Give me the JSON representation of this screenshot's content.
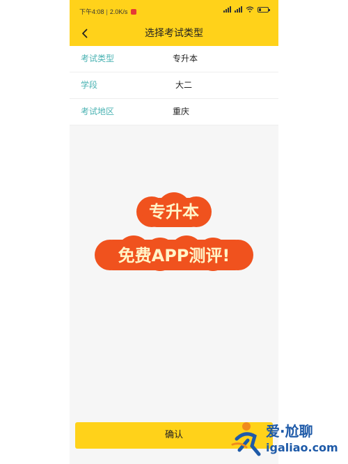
{
  "status_bar": {
    "time": "下午4:08",
    "speed": "2.0K/s",
    "separator": "|"
  },
  "header": {
    "title": "选择考试类型",
    "back_icon": "chevron-left-icon"
  },
  "info": {
    "rows": [
      {
        "label": "考试类型",
        "value": "专升本"
      },
      {
        "label": "学段",
        "value": "大二"
      },
      {
        "label": "考试地区",
        "value": "重庆"
      }
    ]
  },
  "promo": {
    "line1": "专升本",
    "line2": "免费APP测评!"
  },
  "footer": {
    "confirm_label": "确认"
  },
  "watermark": {
    "text_cn": "爱·尬聊",
    "text_url": "igaliao.com"
  },
  "colors": {
    "accent_yellow": "#ffd21a",
    "label_teal": "#4bb3b3",
    "promo_red": "#f0521e",
    "promo_text": "#fff4c8",
    "watermark_blue": "#1e5aa8",
    "watermark_orange": "#f08a1c"
  }
}
